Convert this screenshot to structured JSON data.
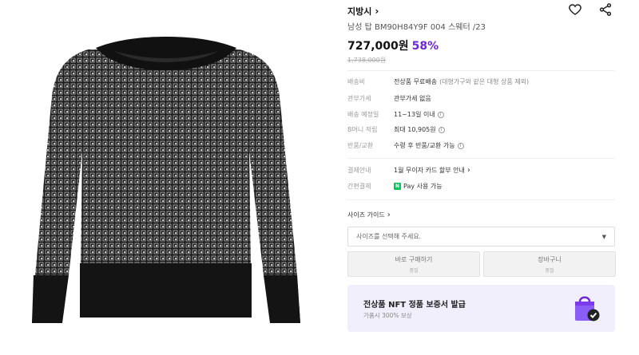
{
  "product": {
    "brand": "지방시",
    "title": "남성 탑 BM90H84Y9F 004 스웨터 /23",
    "price": "727,000원",
    "discount": "58%",
    "original_price": "1,738,000원"
  },
  "icons": {
    "brand_chevron": "chevron-right-icon",
    "wishlist": "heart-icon",
    "share": "share-icon",
    "info": "info-icon",
    "naver_pay": "naver-pay-icon",
    "dropdown": "caret-down-icon",
    "nft": "shopping-bag-check-icon"
  },
  "specs": {
    "shipping_fee": {
      "label": "배송비",
      "value": "전상품 무료배송",
      "note": "(대형가구와 같은 대형 상품 제외)"
    },
    "customs": {
      "label": "관부가세",
      "value": "관부가세 없음"
    },
    "delivery_date": {
      "label": "배송 예정일",
      "value": "11~13일 이내"
    },
    "points": {
      "label": "B머니 적립",
      "value": "최대 10,905원"
    },
    "returns": {
      "label": "반품/교환",
      "value": "수령 후 반품/교환 가능"
    }
  },
  "payment": {
    "guide": {
      "label": "결제안내",
      "value": "1월 무이자 카드 할부 안내"
    },
    "easy": {
      "label": "간편결제",
      "badge": "N",
      "value": "Pay 사용 가능"
    }
  },
  "size_guide": "사이즈 가이드",
  "size_select": {
    "placeholder": "사이즈를 선택해 주세요."
  },
  "buttons": {
    "buy": {
      "label": "바로 구매하기",
      "sub": "품절"
    },
    "cart": {
      "label": "장바구니",
      "sub": "품절"
    }
  },
  "nft_banner": {
    "title": "전상품 NFT 정품 보증서 발급",
    "subtitle": "가품시 300% 보상"
  },
  "colors": {
    "discount": "#6d28d9",
    "nft_bg": "#f1effc",
    "bag": "#8b5cf6",
    "naver_pay": "#03c75a"
  }
}
